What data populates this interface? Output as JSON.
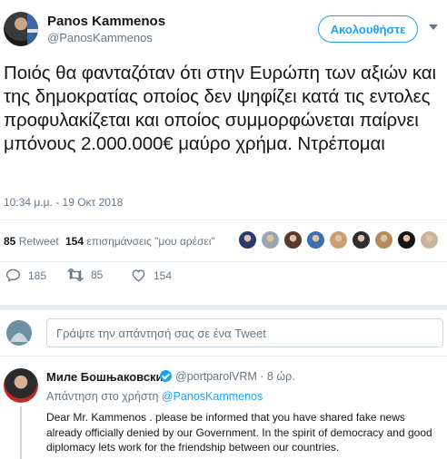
{
  "author": {
    "display_name": "Panos Kammenos",
    "handle": "@PanosKammenos",
    "follow_label": "Ακολουθήστε"
  },
  "tweet": {
    "text": "Ποιός θα φανταζόταν ότι στην Ευρώπη των αξιών και της δημοκρατίας οποίος δεν ψηφίζει κατά τις εντολες προφυλακίζεται και οποίος συμμορφώνεται παίρνει μπόνους 2.000.000€ μαύρο χρήμα. Ντρέπομαι",
    "timestamp": "10:34 μ.μ. - 19 Οκτ 2018"
  },
  "stats": {
    "retweets_count": "85",
    "retweets_label": "Retweet",
    "likes_count": "154",
    "likes_label": "επισημάνσεις \"μου αρέσει\"",
    "likers_colors": [
      "#2b3a6b",
      "#9aa5b1",
      "#5a3b2a",
      "#3d6fb0",
      "#caa070",
      "#2f2f2f",
      "#b58a5c",
      "#151515",
      "#c7b79a"
    ]
  },
  "actions": {
    "reply_count": "185",
    "retweet_count": "85",
    "like_count": "154",
    "icons": [
      "reply-icon",
      "retweet-icon",
      "heart-icon"
    ]
  },
  "reply_box": {
    "placeholder": "Γράψτε την απάντησή σας σε ένα Tweet"
  },
  "reply_tweet": {
    "display_name": "Миле Бошњаковски",
    "handle": "@portparolVRM · 8 ώρ.",
    "replying_prefix": "Απάντηση στο χρήστη",
    "replying_to": "@PanosKammenos",
    "text": "Dear Mr. Kammenos . please be informed that you have shared fake news already officially denied by our Government. In the spirit of democracy and good diplomacy lets work for the friendship between our countries."
  },
  "colors": {
    "accent": "#1da1f2",
    "secondary_text": "#657786",
    "divider": "#e6ecf0"
  }
}
